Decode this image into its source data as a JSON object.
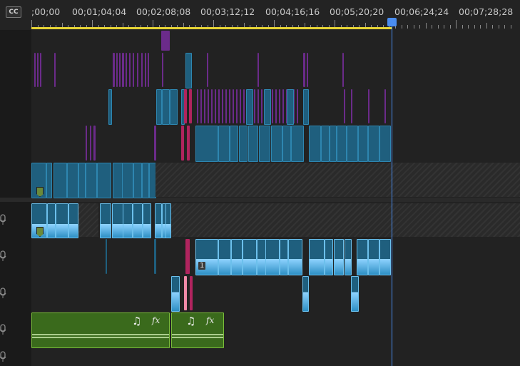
{
  "ruler": {
    "cc_label": "CC",
    "timecodes": [
      ";00;00",
      "00;01;04;04",
      "00;02;08;08",
      "00;03;12;12",
      "00;04;16;16",
      "00;05;20;20",
      "00;06;24;24",
      "00;07;28;28"
    ]
  },
  "colors": {
    "video_clip": "#1f5f7e",
    "video_clip_border": "#2e86b0",
    "audio_clip": "#2d8fc4",
    "waveform": "#8fd3ff",
    "purple_clip": "#6b2b8a",
    "magenta_clip": "#b0245e",
    "music_clip": "#3a6a1c",
    "music_clip_border": "#7bbd3a",
    "playhead": "#4a8df0",
    "work_area": "#e6d436"
  },
  "clip_badge": "1",
  "music_clips": [
    {
      "note": "♫",
      "fx": "fx"
    },
    {
      "note": "♫",
      "fx": "fx"
    }
  ],
  "icons": [
    "closed-captions-icon",
    "microphone-icon",
    "playhead-icon",
    "marker-icon",
    "music-note-icon",
    "fx-badge-icon"
  ]
}
